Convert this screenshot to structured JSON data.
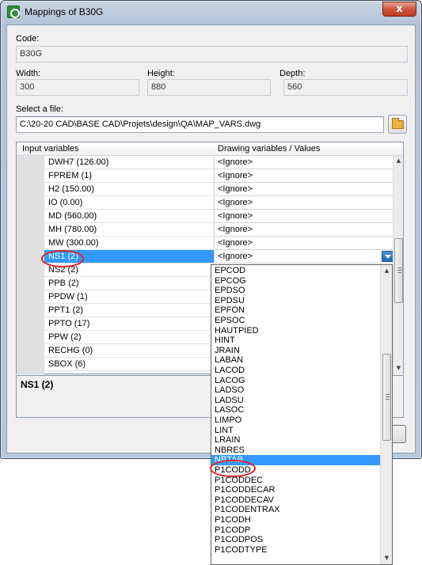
{
  "window": {
    "title": "Mappings of B30G",
    "close_glyph": "x"
  },
  "form": {
    "code_label": "Code:",
    "code_value": "B30G",
    "width_label": "Width:",
    "width_value": "300",
    "height_label": "Height:",
    "height_value": "880",
    "depth_label": "Depth:",
    "depth_value": "560",
    "file_label": "Select a file:",
    "file_value": "C:\\20-20 CAD\\BASE CAD\\Projets\\design\\QA\\MAP_VARS.dwg"
  },
  "grid": {
    "col_input": "Input variables",
    "col_drawing": "Drawing variables / Values",
    "rows": [
      {
        "name": "DWH7 (126.00)",
        "value": "<Ignore>"
      },
      {
        "name": "FPREM (1)",
        "value": "<Ignore>"
      },
      {
        "name": "H2 (150.00)",
        "value": "<Ignore>"
      },
      {
        "name": "IO (0.00)",
        "value": "<Ignore>"
      },
      {
        "name": "MD (560.00)",
        "value": "<Ignore>"
      },
      {
        "name": "MH (780.00)",
        "value": "<Ignore>"
      },
      {
        "name": "MW (300.00)",
        "value": "<Ignore>"
      },
      {
        "name": "NS1 (2)",
        "value": "<Ignore>"
      },
      {
        "name": "NS2 (2)",
        "value": ""
      },
      {
        "name": "PPB (2)",
        "value": ""
      },
      {
        "name": "PPDW (1)",
        "value": ""
      },
      {
        "name": "PPT1 (2)",
        "value": ""
      },
      {
        "name": "PPTO (17)",
        "value": ""
      },
      {
        "name": "PPW (2)",
        "value": ""
      },
      {
        "name": "RECHG (0)",
        "value": ""
      },
      {
        "name": "SBOX (6)",
        "value": ""
      }
    ],
    "selected_row": "NS1 (2)"
  },
  "description": {
    "text": "NS1 (2)"
  },
  "dropdown": {
    "options": [
      "EPCOD",
      "EPCOG",
      "EPDSO",
      "EPDSU",
      "EPFON",
      "EPSOC",
      "HAUTPIED",
      "HINT",
      "JRAIN",
      "LABAN",
      "LACOD",
      "LACOG",
      "LADSO",
      "LADSU",
      "LASOC",
      "LIMPO",
      "LINT",
      "LRAIN",
      "NBRES",
      "NBTAB",
      "P1CODD",
      "P1CODDEC",
      "P1CODDECAR",
      "P1CODDECAV",
      "P1CODENTRAX",
      "P1CODH",
      "P1CODP",
      "P1CODPOS",
      "P1CODTYPE"
    ],
    "selected": "NBTAB"
  },
  "colors": {
    "selection": "#3399ff",
    "highlight_ring": "#e02020"
  }
}
